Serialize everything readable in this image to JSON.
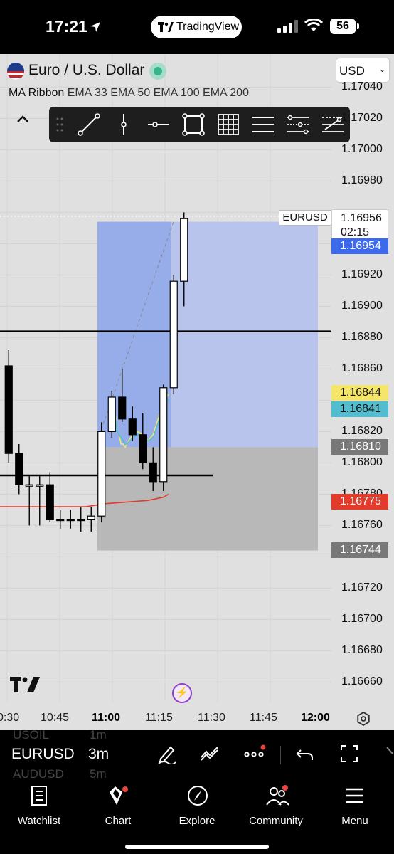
{
  "status_bar": {
    "time": "17:21",
    "app_pill": "TradingView",
    "battery": "56"
  },
  "header": {
    "symbol_title": "Euro / U.S. Dollar",
    "currency": "USD",
    "indicator_name": "MA Ribbon",
    "indicator_params": "EMA 33 EMA 50 EMA 100 EMA 200"
  },
  "drawing_tools": [
    "trend-line",
    "vertical-line",
    "horizontal-line",
    "rectangle",
    "grid",
    "parallel-channel",
    "regression-channel",
    "long-position"
  ],
  "price_axis": {
    "labels": [
      "1.17040",
      "1.17020",
      "1.17000",
      "1.16980",
      "1.16920",
      "1.16900",
      "1.16880",
      "1.16860",
      "1.16820",
      "1.16800",
      "1.16780",
      "1.16760",
      "1.16720",
      "1.16700",
      "1.16680",
      "1.16660"
    ],
    "current_price": "1.16956",
    "countdown": "02:15",
    "symbol_tag": "EURUSD",
    "bid_price": "1.16954",
    "ema33": "1.16844",
    "ema50": "1.16841",
    "stop_price": "1.16810",
    "ema200": "1.16775",
    "target_price": "1.16744"
  },
  "time_axis": [
    "0:30",
    "10:45",
    "11:00",
    "11:15",
    "11:30",
    "11:45",
    "12:00"
  ],
  "colors": {
    "chart_bg": "#e0e0e0",
    "profit_zone": "#b8c4ec",
    "loss_zone": "#b8b8b8",
    "ema33": "#f5e66a",
    "ema50": "#53bdd0",
    "ema200": "#e23b2b",
    "accent": "#3c6aeb"
  },
  "symbol_bar": {
    "ghost_above_symbol": "USOIL",
    "ghost_above_tf": "1m",
    "symbol": "EURUSD",
    "timeframe": "3m",
    "ghost_below_symbol": "AUDUSD",
    "ghost_below_tf": "5m"
  },
  "nav": {
    "watchlist": "Watchlist",
    "chart": "Chart",
    "explore": "Explore",
    "community": "Community",
    "menu": "Menu"
  },
  "chart_data": {
    "type": "candlestick",
    "x": [
      "10:30",
      "10:33",
      "10:36",
      "10:39",
      "10:42",
      "10:45",
      "10:48",
      "10:51",
      "10:54",
      "10:57",
      "11:00",
      "11:03",
      "11:06",
      "11:09",
      "11:12",
      "11:15",
      "11:18",
      "11:21"
    ],
    "open": [
      1.16862,
      1.16806,
      1.16786,
      1.16786,
      1.16786,
      1.16764,
      1.16764,
      1.16764,
      1.16764,
      1.16766,
      1.1682,
      1.16842,
      1.16828,
      1.16818,
      1.168,
      1.16788,
      1.16848,
      1.16916
    ],
    "high": [
      1.16872,
      1.16812,
      1.16792,
      1.16792,
      1.16794,
      1.1677,
      1.1677,
      1.16772,
      1.16772,
      1.16826,
      1.16846,
      1.1686,
      1.16836,
      1.16832,
      1.1681,
      1.1685,
      1.1692,
      1.1696
    ],
    "low": [
      1.168,
      1.1678,
      1.1676,
      1.1676,
      1.16762,
      1.16758,
      1.16758,
      1.16756,
      1.16756,
      1.16762,
      1.16816,
      1.16826,
      1.16814,
      1.16796,
      1.16782,
      1.16782,
      1.16844,
      1.169
    ],
    "close": [
      1.16806,
      1.16786,
      1.16786,
      1.16786,
      1.16764,
      1.16764,
      1.16764,
      1.16764,
      1.16766,
      1.1682,
      1.16842,
      1.16828,
      1.16818,
      1.168,
      1.16788,
      1.16848,
      1.16916,
      1.16956
    ],
    "ema33_series": [
      [
        10.8,
        1.16832
      ],
      [
        11.0,
        1.16822
      ],
      [
        11.2,
        1.16818
      ],
      [
        11.4,
        1.16812
      ],
      [
        11.6,
        1.16812
      ],
      [
        11.8,
        1.1681
      ],
      [
        11.95,
        1.16812
      ],
      [
        12.5,
        1.16818
      ],
      [
        13.0,
        1.1682
      ],
      [
        13.5,
        1.16818
      ],
      [
        14.0,
        1.16814
      ],
      [
        14.5,
        1.16818
      ],
      [
        15.0,
        1.16828
      ],
      [
        15.5,
        1.16838
      ],
      [
        16.0,
        1.16844
      ]
    ],
    "ema50_series": [
      [
        10.8,
        1.1683
      ],
      [
        11.0,
        1.16822
      ],
      [
        11.2,
        1.16818
      ],
      [
        11.4,
        1.16816
      ],
      [
        11.6,
        1.16814
      ],
      [
        11.8,
        1.16812
      ],
      [
        11.95,
        1.16812
      ],
      [
        12.5,
        1.16816
      ],
      [
        13.0,
        1.16818
      ],
      [
        13.5,
        1.16816
      ],
      [
        14.0,
        1.16814
      ],
      [
        14.5,
        1.16816
      ],
      [
        15.0,
        1.16826
      ],
      [
        15.5,
        1.16834
      ],
      [
        16.0,
        1.16841
      ]
    ],
    "ema200_series": [
      [
        -0.5,
        1.16772
      ],
      [
        2.0,
        1.16772
      ],
      [
        4.0,
        1.16772
      ],
      [
        6.0,
        1.16772
      ],
      [
        8.0,
        1.16772
      ],
      [
        10.0,
        1.16774
      ],
      [
        12.0,
        1.16775
      ],
      [
        14.0,
        1.16776
      ],
      [
        15.5,
        1.16778
      ],
      [
        16.0,
        1.1678
      ]
    ],
    "horizontal_lines": [
      1.16884,
      1.16792
    ],
    "long_position": {
      "entry": 1.1681,
      "target": 1.16954,
      "stop": 1.16744
    },
    "ylim": [
      1.16652,
      1.17052
    ]
  }
}
